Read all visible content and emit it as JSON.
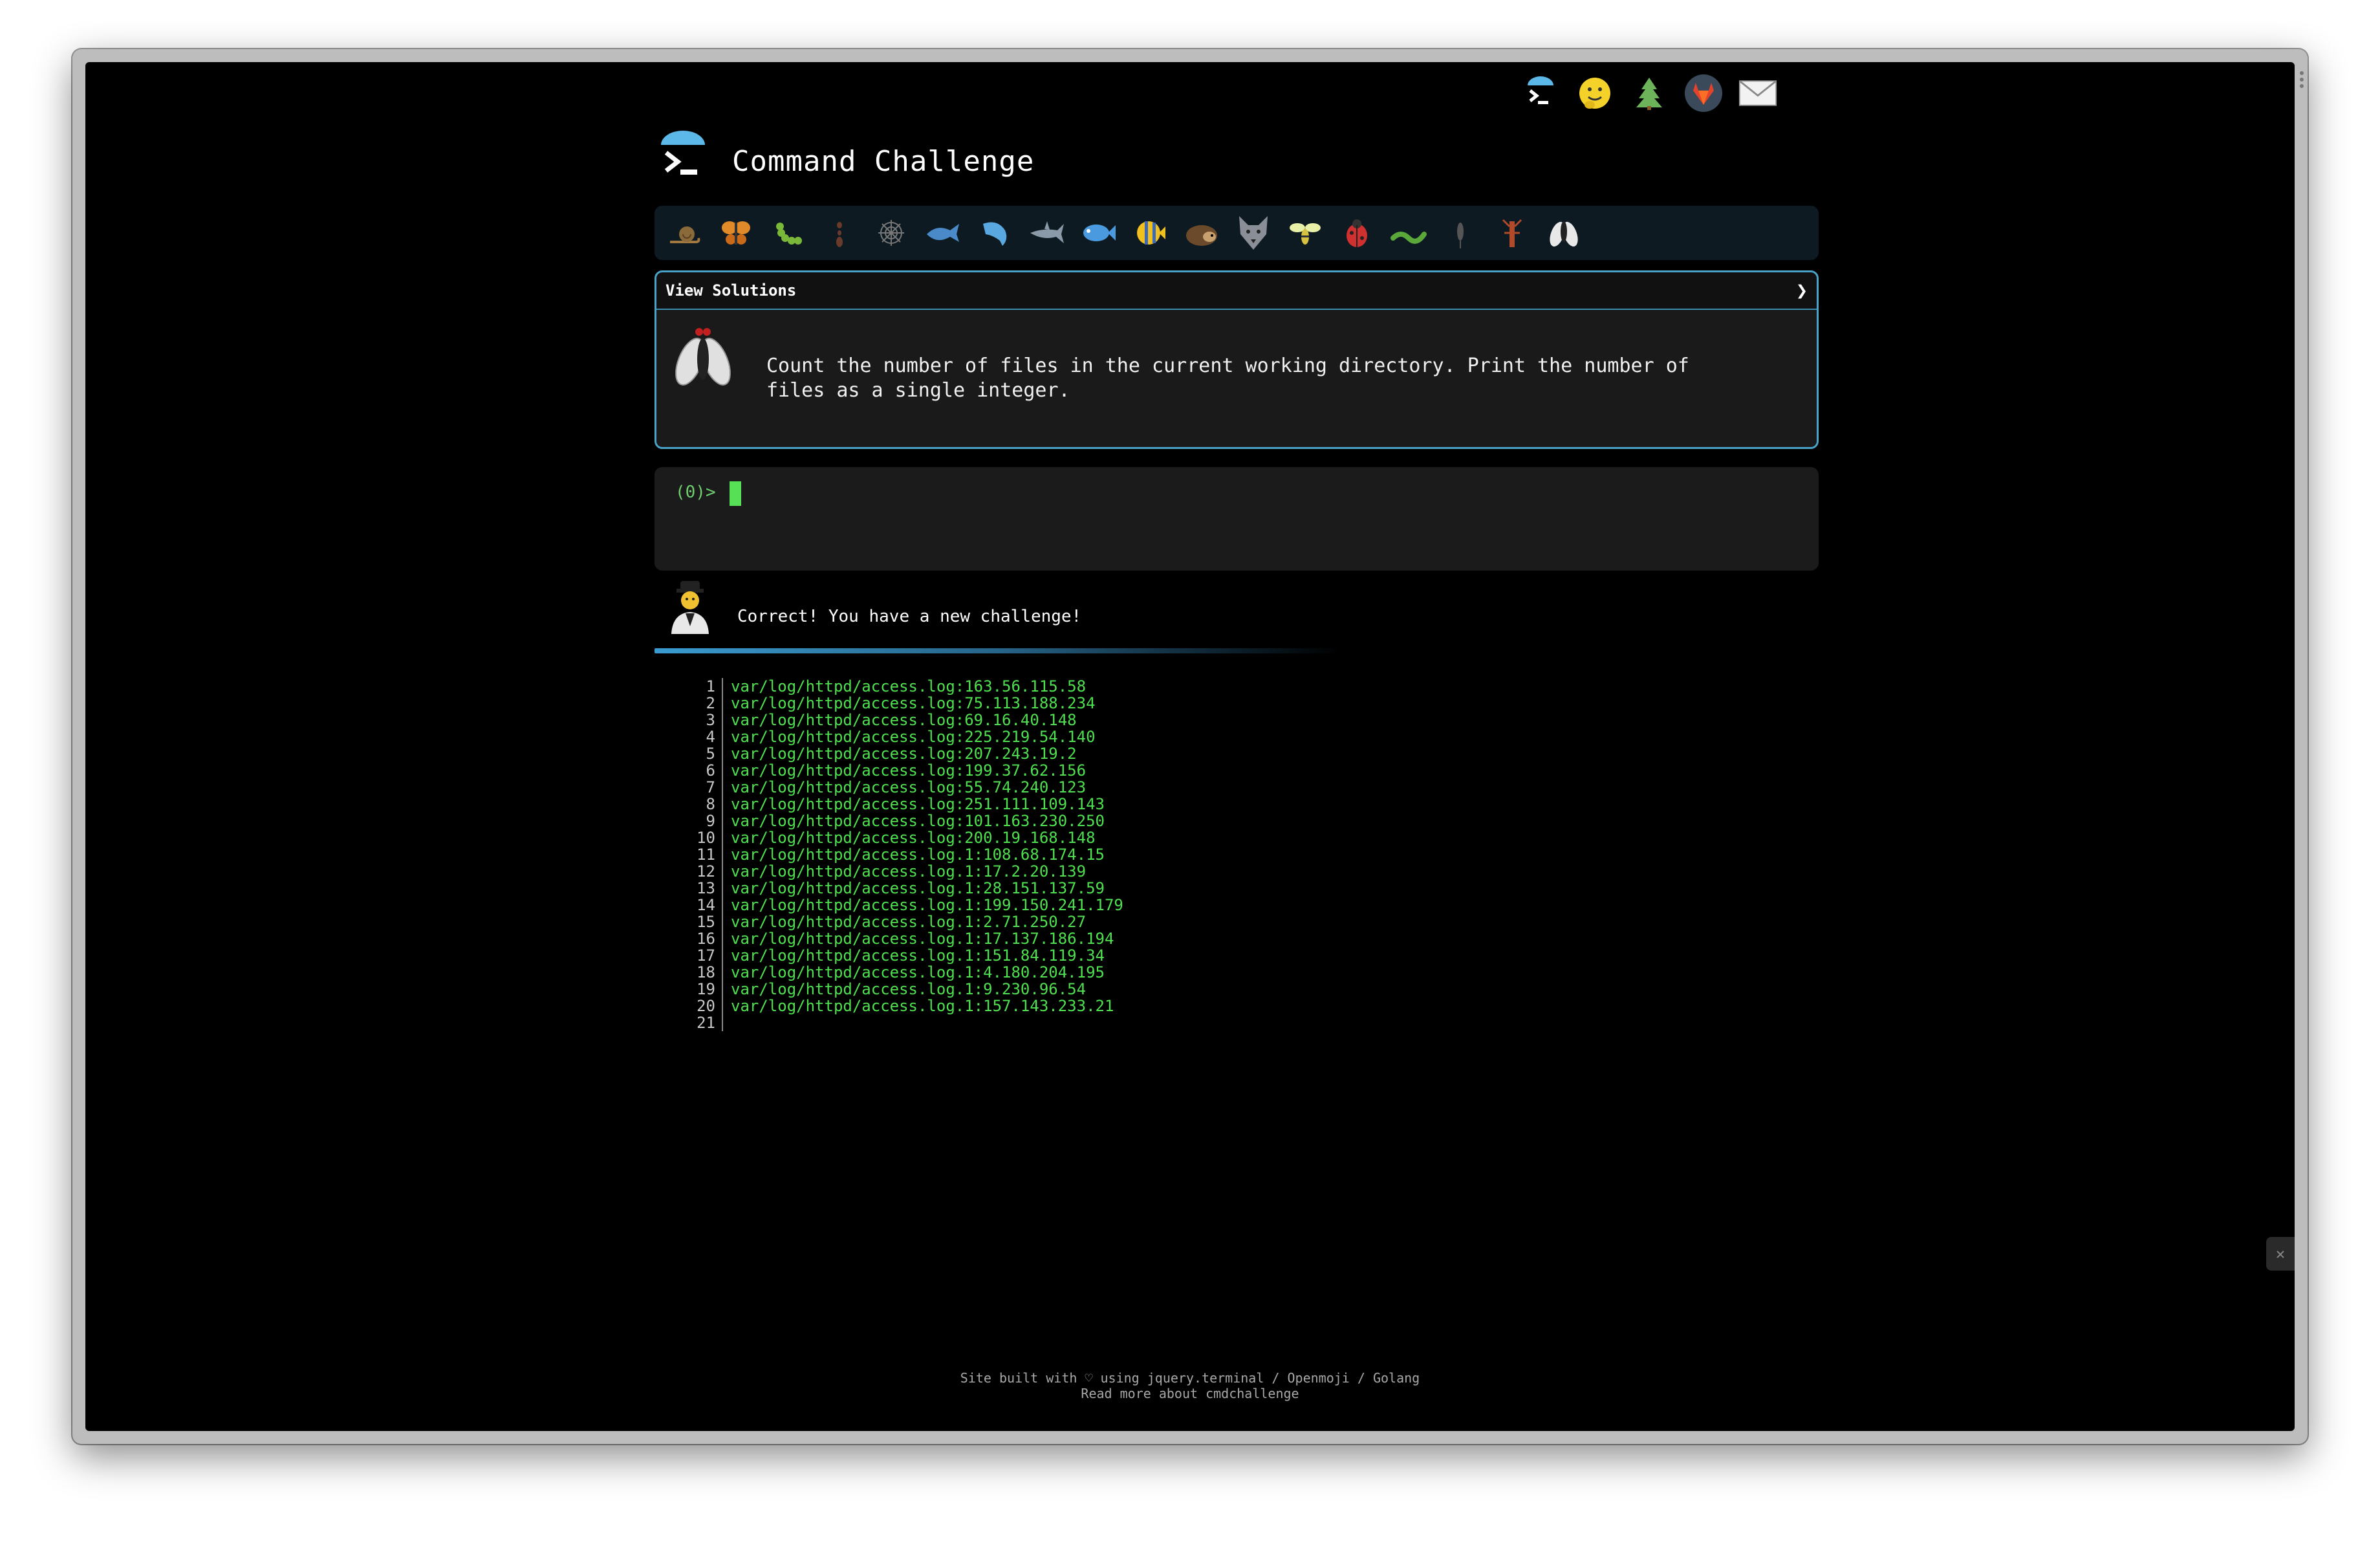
{
  "app": {
    "title": "Command Challenge"
  },
  "top_icons": [
    "terminal-logo-icon",
    "hugging-face-icon",
    "evergreen-tree-icon",
    "gitlab-fox-icon",
    "envelope-icon"
  ],
  "challenge_bar": {
    "emojis": [
      "snail-icon",
      "butterfly-icon",
      "caterpillar-icon",
      "ant-icon",
      "spider-web-icon",
      "whale-icon",
      "dolphin-icon",
      "shark-icon",
      "fish-icon",
      "tropical-fish-icon",
      "hedgehog-icon",
      "wolf-icon",
      "bee-icon",
      "lady-beetle-icon",
      "worm-icon",
      "mosquito-icon",
      "scorpion-icon",
      "fly-icon"
    ]
  },
  "panel": {
    "header": "View Solutions",
    "chevron": "❯",
    "description": "Count the number of files in the current working directory. Print the number of files as a single integer."
  },
  "terminal": {
    "prompt": "(0)>"
  },
  "message": {
    "text": "Correct! You have a new challenge!"
  },
  "log_lines": [
    {
      "n": "1",
      "t": "var/log/httpd/access.log:163.56.115.58"
    },
    {
      "n": "2",
      "t": "var/log/httpd/access.log:75.113.188.234"
    },
    {
      "n": "3",
      "t": "var/log/httpd/access.log:69.16.40.148"
    },
    {
      "n": "4",
      "t": "var/log/httpd/access.log:225.219.54.140"
    },
    {
      "n": "5",
      "t": "var/log/httpd/access.log:207.243.19.2"
    },
    {
      "n": "6",
      "t": "var/log/httpd/access.log:199.37.62.156"
    },
    {
      "n": "7",
      "t": "var/log/httpd/access.log:55.74.240.123"
    },
    {
      "n": "8",
      "t": "var/log/httpd/access.log:251.111.109.143"
    },
    {
      "n": "9",
      "t": "var/log/httpd/access.log:101.163.230.250"
    },
    {
      "n": "10",
      "t": "var/log/httpd/access.log:200.19.168.148"
    },
    {
      "n": "11",
      "t": "var/log/httpd/access.log.1:108.68.174.15"
    },
    {
      "n": "12",
      "t": "var/log/httpd/access.log.1:17.2.20.139"
    },
    {
      "n": "13",
      "t": "var/log/httpd/access.log.1:28.151.137.59"
    },
    {
      "n": "14",
      "t": "var/log/httpd/access.log.1:199.150.241.179"
    },
    {
      "n": "15",
      "t": "var/log/httpd/access.log.1:2.71.250.27"
    },
    {
      "n": "16",
      "t": "var/log/httpd/access.log.1:17.137.186.194"
    },
    {
      "n": "17",
      "t": "var/log/httpd/access.log.1:151.84.119.34"
    },
    {
      "n": "18",
      "t": "var/log/httpd/access.log.1:4.180.204.195"
    },
    {
      "n": "19",
      "t": "var/log/httpd/access.log.1:9.230.96.54"
    },
    {
      "n": "20",
      "t": "var/log/httpd/access.log.1:157.143.233.21"
    },
    {
      "n": "21",
      "t": ""
    }
  ],
  "footer": {
    "line1": "Site built with ♡ using jquery.terminal / Openmoji / Golang",
    "line2": "Read more about cmdchallenge"
  },
  "colors": {
    "accent": "#4aa3c8",
    "terminal_green": "#4fe04f",
    "background": "#000000"
  }
}
